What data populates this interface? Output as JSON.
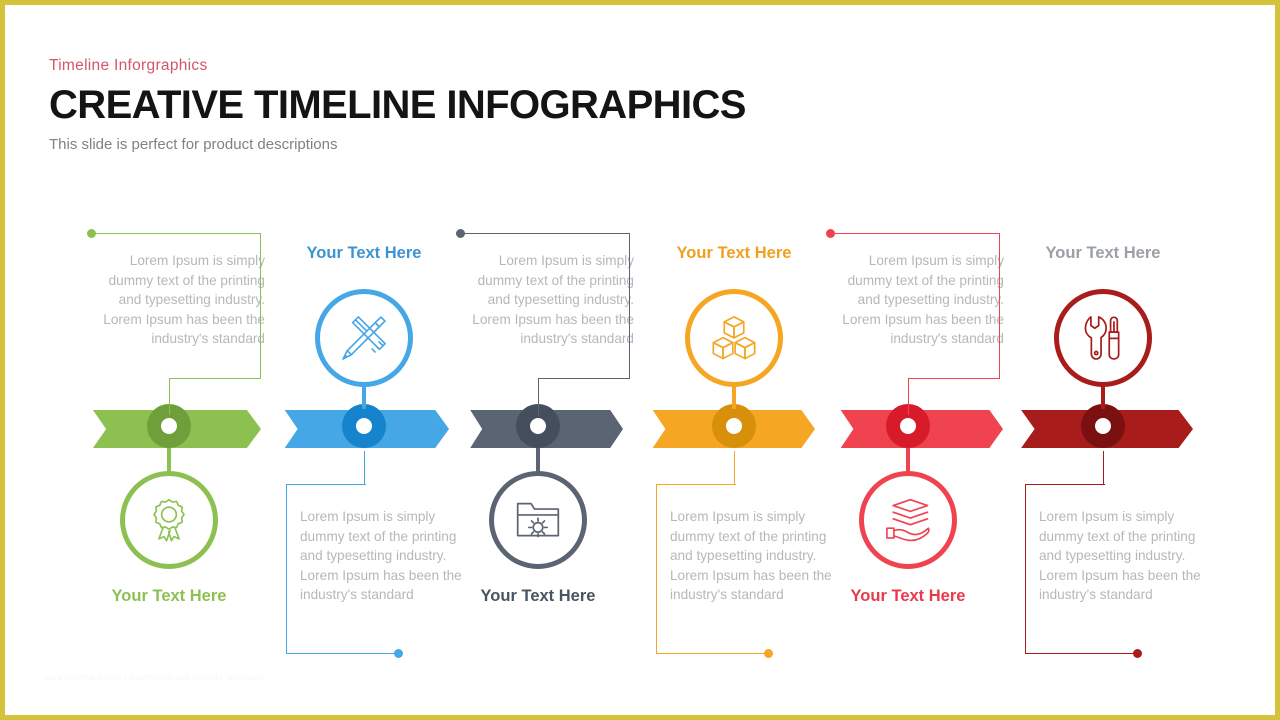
{
  "header": {
    "eyebrow": "Timeline  Inforgraphics",
    "title": "CREATIVE TIMELINE INFOGRAPHICS",
    "subtitle": "This slide is perfect for product descriptions"
  },
  "watermark": "www.slidehack.com  |  powerpoint and keynote templates",
  "body_text": "Lorem Ipsum is simply dummy text of the printing and typesetting industry. Lorem Ipsum has been the industry's standard",
  "colors": {
    "green": "#8cc152",
    "green_dark": "#6e9f3b",
    "blue": "#45a7e6",
    "blue_dark": "#1584cc",
    "slate": "#5a6472",
    "slate_dark": "#454e5c",
    "orange": "#f5a623",
    "orange_dark": "#d8900a",
    "red": "#ef4350",
    "red_dark": "#d81b2a",
    "darkred": "#a81c1c",
    "darkred_dark": "#7a1010",
    "body_gray": "#b4b8bc",
    "heading_gray": "#9aa0a6",
    "eyebrow": "#d2566a",
    "title": "#141414",
    "subtitle": "#7e8286",
    "frame": "#d4c23a"
  },
  "segments": [
    {
      "id": "segment-1",
      "position": "text-top-icon-bottom",
      "color": "#8cc152",
      "color_dark": "#6e9f3b",
      "heading": "Your Text Here",
      "heading_color": "#8cc152",
      "icon": "award-ribbon-icon",
      "text": "Lorem Ipsum is simply dummy text of the printing and typesetting industry.  Lorem Ipsum has been the industry's standard"
    },
    {
      "id": "segment-2",
      "position": "icon-top-text-bottom",
      "color": "#45a7e6",
      "color_dark": "#1584cc",
      "heading": "Your Text Here",
      "heading_color": "#3b93d4",
      "icon": "pencil-ruler-icon",
      "text": "Lorem Ipsum is simply dummy text of the printing and typesetting industry. Lorem Ipsum has been the industry's standard"
    },
    {
      "id": "segment-3",
      "position": "text-top-icon-bottom",
      "color": "#5a6472",
      "color_dark": "#454e5c",
      "heading": "Your Text Here",
      "heading_color": "#4a5360",
      "icon": "folder-gear-icon",
      "text": "Lorem Ipsum is simply dummy text of the printing and typesetting industry. Lorem Ipsum has been the industry's standard"
    },
    {
      "id": "segment-4",
      "position": "icon-top-text-bottom",
      "color": "#f5a623",
      "color_dark": "#d8900a",
      "heading": "Your Text Here",
      "heading_color": "#f0a01e",
      "icon": "stacked-boxes-icon",
      "text": "Lorem Ipsum is simply dummy text of the printing and typesetting industry. Lorem Ipsum has been the industry's standard"
    },
    {
      "id": "segment-5",
      "position": "text-top-icon-bottom",
      "color": "#ef4350",
      "color_dark": "#d81b2a",
      "heading": "Your Text Here",
      "heading_color": "#e8394c",
      "icon": "hand-layers-icon",
      "text": "Lorem Ipsum is simply dummy text of the printing and typesetting industry. Lorem Ipsum has been the industry's standard"
    },
    {
      "id": "segment-6",
      "position": "icon-top-text-bottom",
      "color": "#a81c1c",
      "color_dark": "#7a1010",
      "heading": "Your Text Here",
      "heading_color": "#9aa0a6",
      "icon": "wrench-screwdriver-icon",
      "text": "Lorem Ipsum is simply dummy text of the printing and typesetting industry. Lorem Ipsum has been the industry's standard"
    }
  ]
}
